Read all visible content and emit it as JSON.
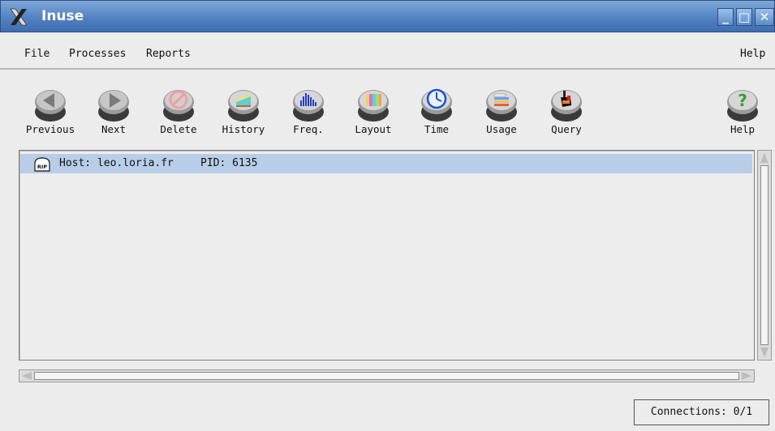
{
  "window": {
    "title": "Inuse",
    "minimize_icon": "minimize-icon",
    "maximize_icon": "maximize-icon",
    "close_icon": "close-icon",
    "titlebar_color": "#4f7fc0"
  },
  "menubar": {
    "file": "File",
    "processes": "Processes",
    "reports": "Reports",
    "help": "Help"
  },
  "toolbar": {
    "previous": "Previous",
    "next": "Next",
    "delete": "Delete",
    "history": "History",
    "freq": "Freq.",
    "layout": "Layout",
    "time": "Time",
    "usage": "Usage",
    "query": "Query",
    "help": "Help"
  },
  "list": {
    "rows": [
      {
        "host": "Host: leo.loria.fr",
        "pid": "PID: 6135",
        "icon": "rip-tombstone-icon",
        "icon_text": "RIP"
      }
    ],
    "selected_color": "#b8cde8"
  },
  "status": {
    "connections": "Connections: 0/1"
  }
}
